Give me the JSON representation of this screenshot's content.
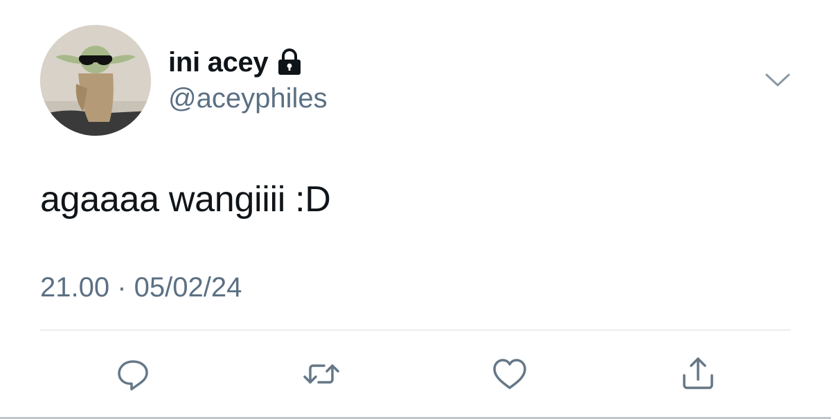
{
  "header": {
    "display_name": "ini acey",
    "handle": "@aceyphiles",
    "avatar_icon": "baby-yoda-avatar",
    "protected_icon": "lock-icon",
    "menu_icon": "chevron-down-icon"
  },
  "tweet": {
    "text": "agaaaa wangiiii :D",
    "timestamp": "21.00 · 05/02/24"
  },
  "actions": [
    {
      "icon": "reply-icon"
    },
    {
      "icon": "retweet-icon"
    },
    {
      "icon": "like-icon"
    },
    {
      "icon": "share-icon"
    }
  ],
  "colors": {
    "text": "#0f1419",
    "secondary": "#5b7083",
    "divider": "#d9dee2"
  }
}
